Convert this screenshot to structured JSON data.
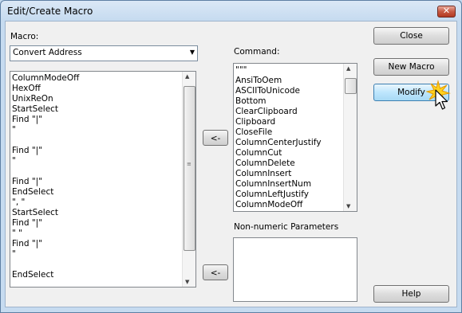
{
  "window": {
    "title": "Edit/Create Macro",
    "close_glyph": "✕"
  },
  "macro_label": "Macro:",
  "macro_select": {
    "value": "Convert Address",
    "arrow": "▼"
  },
  "macro_lines": [
    "ColumnModeOff",
    "HexOff",
    "UnixReOn",
    "StartSelect",
    "Find \"|\"",
    "\"",
    "",
    "Find \"|\"",
    "\"",
    "",
    "Find \"|\"",
    "EndSelect",
    "\", \"",
    "StartSelect",
    "Find \"|\"",
    "\" \"",
    "Find \"|\"",
    "\"",
    "",
    "EndSelect"
  ],
  "command_label": "Command:",
  "commands": [
    "\"\"\"",
    "AnsiToOem",
    "ASCIIToUnicode",
    "Bottom",
    "ClearClipboard",
    "Clipboard",
    "CloseFile",
    "ColumnCenterJustify",
    "ColumnCut",
    "ColumnDelete",
    "ColumnInsert",
    "ColumnInsertNum",
    "ColumnLeftJustify",
    "ColumnModeOff"
  ],
  "params_label": "Non-numeric Parameters",
  "buttons": {
    "insert_command": "<-",
    "insert_param": "<-",
    "close": "Close",
    "new_macro": "New Macro",
    "modify": "Modify",
    "help": "Help"
  },
  "icons": {
    "scroll_up": "▲",
    "scroll_down": "▼",
    "grip": "≡",
    "pointer": "mouse-pointer-icon"
  }
}
